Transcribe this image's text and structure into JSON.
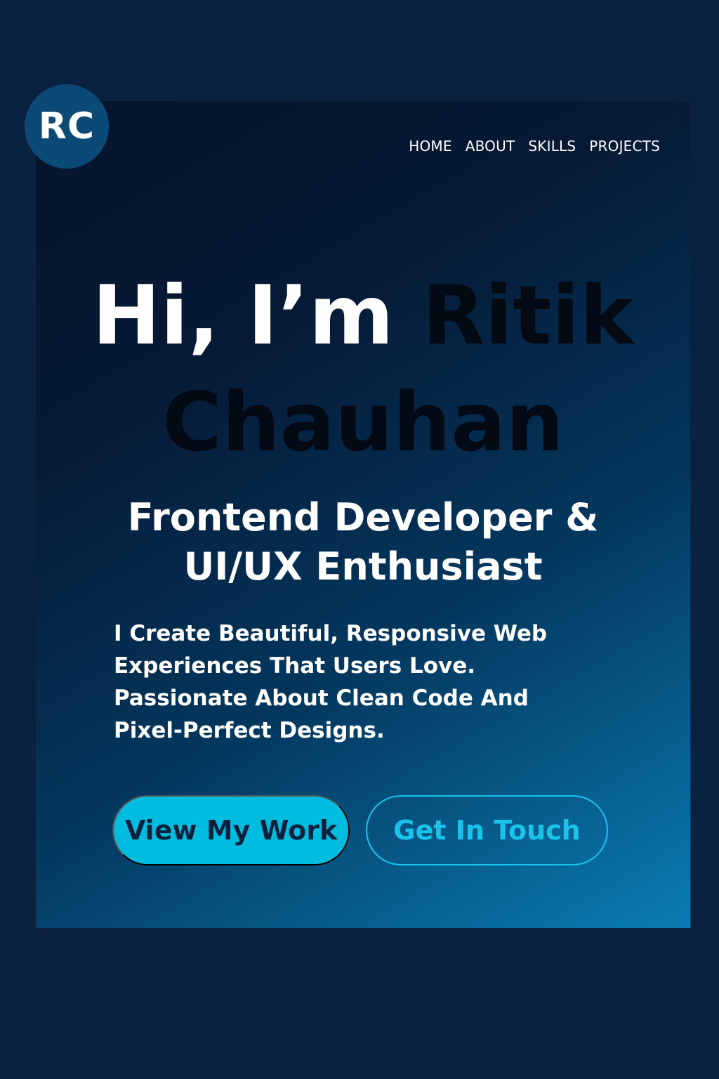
{
  "logo": {
    "initials": "RC"
  },
  "nav": {
    "items": [
      "HOME",
      "ABOUT",
      "SKILLS",
      "PROJECTS"
    ]
  },
  "hero": {
    "greeting": "Hi, I’m",
    "name_first": "Ritik",
    "name_last": "Chauhan",
    "subtitle_line1": "Frontend Developer &",
    "subtitle_line2": "UI/UX Enthusiast",
    "description": "I Create Beautiful, Responsive Web Experiences That Users Love. Passionate About Clean Code And Pixel-Perfect Designs."
  },
  "buttons": {
    "primary_label": "View My Work",
    "secondary_label": "Get In Touch"
  },
  "colors": {
    "page_background": "#0a2240",
    "accent": "#00bde0",
    "logo_background": "#0b4a77",
    "name_text": "#030a14"
  }
}
